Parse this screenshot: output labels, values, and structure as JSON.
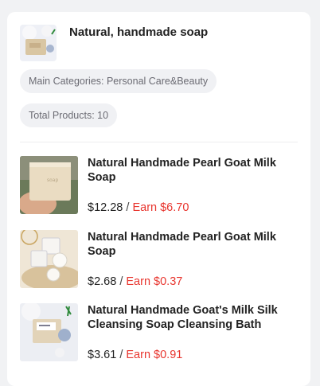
{
  "store": {
    "name": "Natural, handmade soap",
    "categories_label": "Main Categories: Personal Care&Beauty",
    "total_label": "Total Products: 10"
  },
  "products": [
    {
      "title": "Natural Handmade Pearl Goat Milk Soap",
      "price": "$12.28",
      "separator": " / ",
      "earn": "Earn $6.70"
    },
    {
      "title": "Natural Handmade Pearl Goat Milk Soap",
      "price": "$2.68",
      "separator": " / ",
      "earn": "Earn $0.37"
    },
    {
      "title": "Natural Handmade Goat's Milk Silk Cleansing Soap Cleansing Bath",
      "price": "$3.61",
      "separator": " / ",
      "earn": "Earn $0.91"
    }
  ],
  "colors": {
    "background": "#f1f2f4",
    "card": "#ffffff",
    "pill": "#f0f1f4",
    "earn": "#e8352e",
    "text": "#222222"
  }
}
